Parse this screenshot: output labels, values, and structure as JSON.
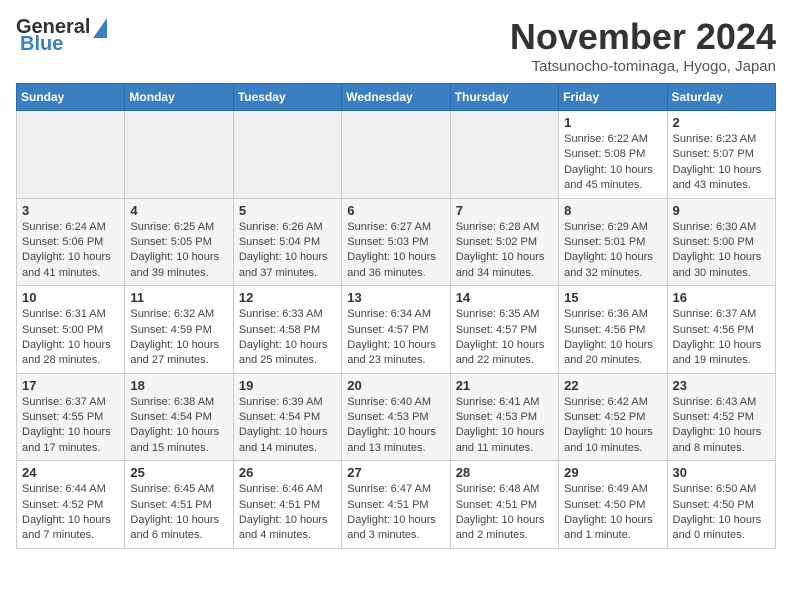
{
  "header": {
    "logo_general": "General",
    "logo_blue": "Blue",
    "month_year": "November 2024",
    "location": "Tatsunocho-tominaga, Hyogo, Japan"
  },
  "weekdays": [
    "Sunday",
    "Monday",
    "Tuesday",
    "Wednesday",
    "Thursday",
    "Friday",
    "Saturday"
  ],
  "weeks": [
    {
      "days": [
        {
          "num": "",
          "info": ""
        },
        {
          "num": "",
          "info": ""
        },
        {
          "num": "",
          "info": ""
        },
        {
          "num": "",
          "info": ""
        },
        {
          "num": "",
          "info": ""
        },
        {
          "num": "1",
          "info": "Sunrise: 6:22 AM\nSunset: 5:08 PM\nDaylight: 10 hours\nand 45 minutes."
        },
        {
          "num": "2",
          "info": "Sunrise: 6:23 AM\nSunset: 5:07 PM\nDaylight: 10 hours\nand 43 minutes."
        }
      ]
    },
    {
      "days": [
        {
          "num": "3",
          "info": "Sunrise: 6:24 AM\nSunset: 5:06 PM\nDaylight: 10 hours\nand 41 minutes."
        },
        {
          "num": "4",
          "info": "Sunrise: 6:25 AM\nSunset: 5:05 PM\nDaylight: 10 hours\nand 39 minutes."
        },
        {
          "num": "5",
          "info": "Sunrise: 6:26 AM\nSunset: 5:04 PM\nDaylight: 10 hours\nand 37 minutes."
        },
        {
          "num": "6",
          "info": "Sunrise: 6:27 AM\nSunset: 5:03 PM\nDaylight: 10 hours\nand 36 minutes."
        },
        {
          "num": "7",
          "info": "Sunrise: 6:28 AM\nSunset: 5:02 PM\nDaylight: 10 hours\nand 34 minutes."
        },
        {
          "num": "8",
          "info": "Sunrise: 6:29 AM\nSunset: 5:01 PM\nDaylight: 10 hours\nand 32 minutes."
        },
        {
          "num": "9",
          "info": "Sunrise: 6:30 AM\nSunset: 5:00 PM\nDaylight: 10 hours\nand 30 minutes."
        }
      ]
    },
    {
      "days": [
        {
          "num": "10",
          "info": "Sunrise: 6:31 AM\nSunset: 5:00 PM\nDaylight: 10 hours\nand 28 minutes."
        },
        {
          "num": "11",
          "info": "Sunrise: 6:32 AM\nSunset: 4:59 PM\nDaylight: 10 hours\nand 27 minutes."
        },
        {
          "num": "12",
          "info": "Sunrise: 6:33 AM\nSunset: 4:58 PM\nDaylight: 10 hours\nand 25 minutes."
        },
        {
          "num": "13",
          "info": "Sunrise: 6:34 AM\nSunset: 4:57 PM\nDaylight: 10 hours\nand 23 minutes."
        },
        {
          "num": "14",
          "info": "Sunrise: 6:35 AM\nSunset: 4:57 PM\nDaylight: 10 hours\nand 22 minutes."
        },
        {
          "num": "15",
          "info": "Sunrise: 6:36 AM\nSunset: 4:56 PM\nDaylight: 10 hours\nand 20 minutes."
        },
        {
          "num": "16",
          "info": "Sunrise: 6:37 AM\nSunset: 4:56 PM\nDaylight: 10 hours\nand 19 minutes."
        }
      ]
    },
    {
      "days": [
        {
          "num": "17",
          "info": "Sunrise: 6:37 AM\nSunset: 4:55 PM\nDaylight: 10 hours\nand 17 minutes."
        },
        {
          "num": "18",
          "info": "Sunrise: 6:38 AM\nSunset: 4:54 PM\nDaylight: 10 hours\nand 15 minutes."
        },
        {
          "num": "19",
          "info": "Sunrise: 6:39 AM\nSunset: 4:54 PM\nDaylight: 10 hours\nand 14 minutes."
        },
        {
          "num": "20",
          "info": "Sunrise: 6:40 AM\nSunset: 4:53 PM\nDaylight: 10 hours\nand 13 minutes."
        },
        {
          "num": "21",
          "info": "Sunrise: 6:41 AM\nSunset: 4:53 PM\nDaylight: 10 hours\nand 11 minutes."
        },
        {
          "num": "22",
          "info": "Sunrise: 6:42 AM\nSunset: 4:52 PM\nDaylight: 10 hours\nand 10 minutes."
        },
        {
          "num": "23",
          "info": "Sunrise: 6:43 AM\nSunset: 4:52 PM\nDaylight: 10 hours\nand 8 minutes."
        }
      ]
    },
    {
      "days": [
        {
          "num": "24",
          "info": "Sunrise: 6:44 AM\nSunset: 4:52 PM\nDaylight: 10 hours\nand 7 minutes."
        },
        {
          "num": "25",
          "info": "Sunrise: 6:45 AM\nSunset: 4:51 PM\nDaylight: 10 hours\nand 6 minutes."
        },
        {
          "num": "26",
          "info": "Sunrise: 6:46 AM\nSunset: 4:51 PM\nDaylight: 10 hours\nand 4 minutes."
        },
        {
          "num": "27",
          "info": "Sunrise: 6:47 AM\nSunset: 4:51 PM\nDaylight: 10 hours\nand 3 minutes."
        },
        {
          "num": "28",
          "info": "Sunrise: 6:48 AM\nSunset: 4:51 PM\nDaylight: 10 hours\nand 2 minutes."
        },
        {
          "num": "29",
          "info": "Sunrise: 6:49 AM\nSunset: 4:50 PM\nDaylight: 10 hours\nand 1 minute."
        },
        {
          "num": "30",
          "info": "Sunrise: 6:50 AM\nSunset: 4:50 PM\nDaylight: 10 hours\nand 0 minutes."
        }
      ]
    }
  ]
}
